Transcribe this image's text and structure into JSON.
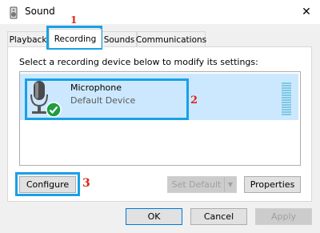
{
  "window": {
    "title": "Sound",
    "close_glyph": "✕"
  },
  "tabs": [
    {
      "label": "Playback",
      "active": false
    },
    {
      "label": "Recording",
      "active": true
    },
    {
      "label": "Sounds",
      "active": false
    },
    {
      "label": "Communications",
      "active": false
    }
  ],
  "instruction": "Select a recording device below to modify its settings:",
  "devices": [
    {
      "name": "Microphone",
      "status": "Default Device",
      "icon": "microphone-icon",
      "badge": "default-check-icon",
      "selected": true
    }
  ],
  "buttons": {
    "configure": "Configure",
    "set_default": "Set Default",
    "properties": "Properties",
    "ok": "OK",
    "cancel": "Cancel",
    "apply": "Apply"
  },
  "annotations": [
    "1",
    "2",
    "3"
  ],
  "colors": {
    "highlight": "#1aa0e6",
    "selection": "#cce8ff",
    "annotation": "#e0241a",
    "check": "#1e9e3f"
  }
}
